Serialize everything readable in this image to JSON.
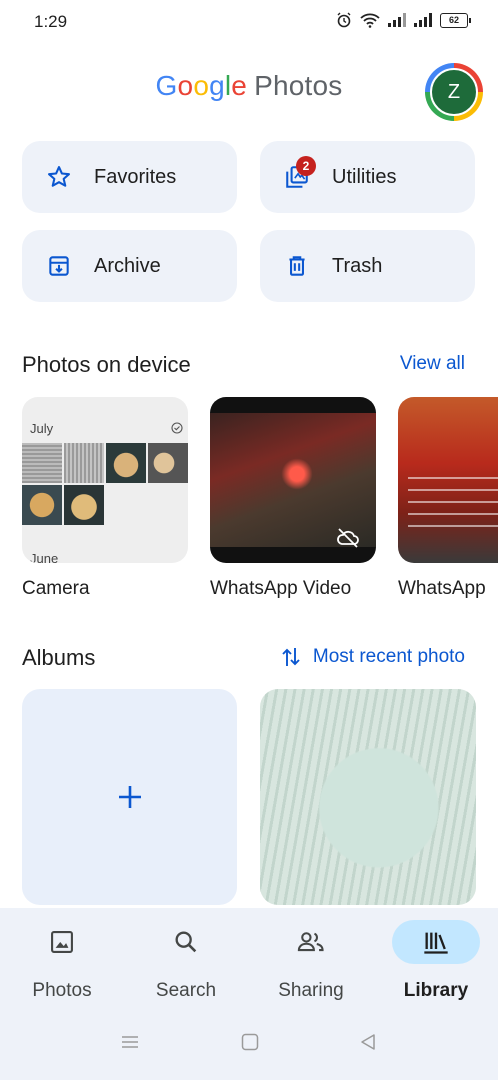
{
  "status": {
    "time": "1:29",
    "battery": "62"
  },
  "header": {
    "logo_parts": [
      "G",
      "o",
      "o",
      "g",
      "l",
      "e"
    ],
    "logo_suffix": "Photos",
    "avatar_initial": "Z"
  },
  "utilities": [
    {
      "label": "Favorites",
      "icon": "star-icon"
    },
    {
      "label": "Utilities",
      "icon": "utilities-icon",
      "badge": "2"
    },
    {
      "label": "Archive",
      "icon": "archive-icon"
    },
    {
      "label": "Trash",
      "icon": "trash-icon"
    }
  ],
  "device_section": {
    "title": "Photos on device",
    "link": "View all"
  },
  "device_folders": [
    {
      "label": "Camera",
      "months": [
        "July",
        "June"
      ]
    },
    {
      "label": "WhatsApp Video"
    },
    {
      "label": "WhatsApp"
    }
  ],
  "albums_section": {
    "title": "Albums",
    "sort_label": "Most recent photo"
  },
  "bottom_nav": [
    {
      "label": "Photos",
      "icon": "photo-icon",
      "active": false
    },
    {
      "label": "Search",
      "icon": "search-icon",
      "active": false
    },
    {
      "label": "Sharing",
      "icon": "people-icon",
      "active": false
    },
    {
      "label": "Library",
      "icon": "library-icon",
      "active": true
    }
  ],
  "colors": {
    "accent": "#0b57d0",
    "card_bg": "#eef2f9",
    "nav_active": "#c2e7ff",
    "badge": "#c5221f"
  }
}
